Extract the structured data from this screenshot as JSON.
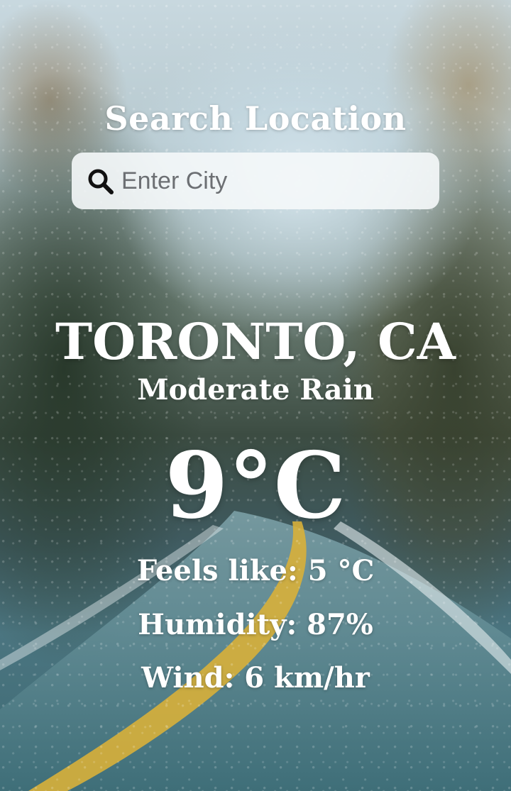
{
  "search": {
    "title": "Search Location",
    "placeholder": "Enter City",
    "value": ""
  },
  "weather": {
    "location": "TORONTO, CA",
    "condition": "Moderate Rain",
    "temperature": "9°C",
    "feels_like": "Feels like: 5 °C",
    "humidity": "Humidity: 87%",
    "wind": "Wind: 6 km/hr"
  },
  "icons": {
    "search": "search-icon"
  },
  "colors": {
    "text": "#ffffff",
    "search_box": "#f5f8fa",
    "placeholder": "#6c6f73"
  }
}
